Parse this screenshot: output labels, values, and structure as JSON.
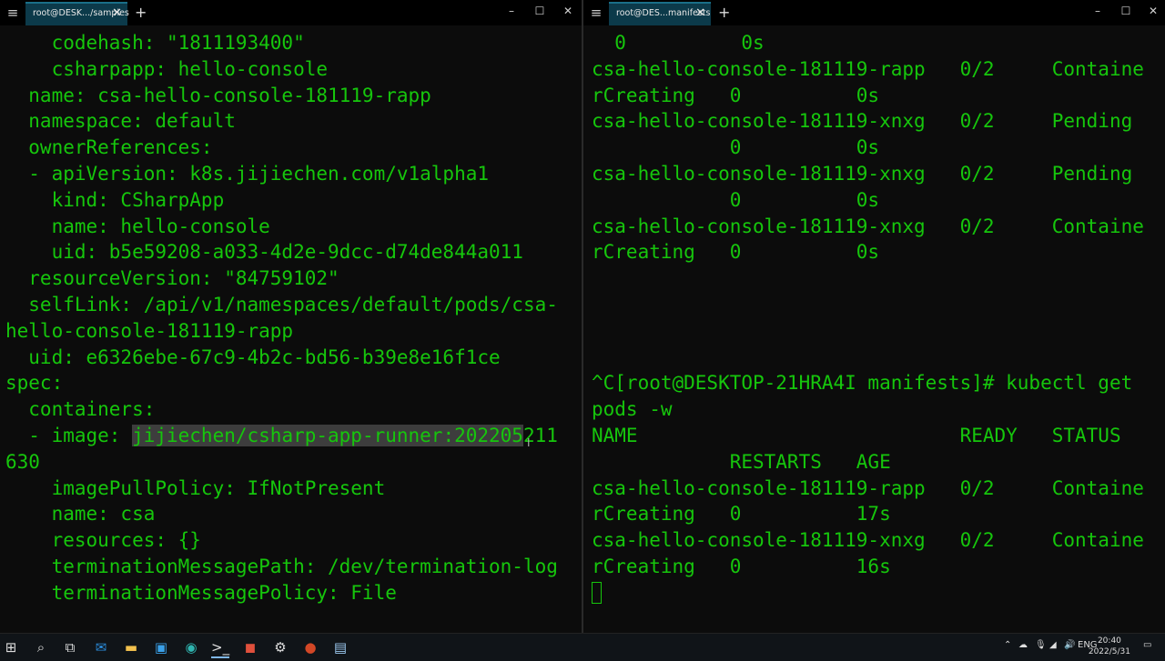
{
  "left_window": {
    "tab_title": "root@DESK.../samples",
    "lines": [
      {
        "text": "    codehash: \"1811193400\""
      },
      {
        "text": "    csharpapp: hello-console"
      },
      {
        "text": "  name: csa-hello-console-181119-rapp"
      },
      {
        "text": "  namespace: default"
      },
      {
        "text": "  ownerReferences:"
      },
      {
        "text": "  - apiVersion: k8s.jijiechen.com/v1alpha1"
      },
      {
        "text": "    kind: CSharpApp"
      },
      {
        "text": "    name: hello-console"
      },
      {
        "text": "    uid: b5e59208-a033-4d2e-9dcc-d74de844a011"
      },
      {
        "text": "  resourceVersion: \"84759102\""
      },
      {
        "text": "  selfLink: /api/v1/namespaces/default/pods/csa-"
      },
      {
        "text": "hello-console-181119-rapp"
      },
      {
        "text": "  uid: e6326ebe-67c9-4b2c-bd56-b39e8e16f1ce"
      },
      {
        "text": "spec:"
      },
      {
        "text": "  containers:"
      },
      {
        "pre": "  - image: ",
        "hl": "jijiechen/csharp-app-runner:202205",
        "post": "211"
      },
      {
        "text": "630"
      },
      {
        "text": "    imagePullPolicy: IfNotPresent"
      },
      {
        "text": "    name: csa"
      },
      {
        "text": "    resources: {}"
      },
      {
        "text": "    terminationMessagePath: /dev/termination-log"
      },
      {
        "text": "    terminationMessagePolicy: File"
      }
    ]
  },
  "right_window": {
    "tab_title": "root@DES...manifests",
    "lines": [
      {
        "text": "  0          0s"
      },
      {
        "text": "csa-hello-console-181119-rapp   0/2     Containe"
      },
      {
        "text": "rCreating   0          0s"
      },
      {
        "text": "csa-hello-console-181119-xnxg   0/2     Pending"
      },
      {
        "text": "            0          0s"
      },
      {
        "text": "csa-hello-console-181119-xnxg   0/2     Pending"
      },
      {
        "text": "            0          0s"
      },
      {
        "text": "csa-hello-console-181119-xnxg   0/2     Containe"
      },
      {
        "text": "rCreating   0          0s"
      },
      {
        "text": ""
      },
      {
        "text": ""
      },
      {
        "text": ""
      },
      {
        "text": ""
      },
      {
        "text": "^C[root@DESKTOP-21HRA4I manifests]# kubectl get"
      },
      {
        "text": "pods -w"
      },
      {
        "text": "NAME                            READY   STATUS"
      },
      {
        "text": "            RESTARTS   AGE"
      },
      {
        "text": "csa-hello-console-181119-rapp   0/2     Containe"
      },
      {
        "text": "rCreating   0          17s"
      },
      {
        "text": "csa-hello-console-181119-xnxg   0/2     Containe"
      },
      {
        "text": "rCreating   0          16s"
      },
      {
        "cursor": true
      }
    ]
  },
  "taskbar": {
    "icons": [
      "windows-start-icon",
      "search-icon",
      "task-view-icon",
      "mail-icon",
      "file-explorer-icon",
      "photos-icon",
      "edge-icon",
      "terminal-icon",
      "app-icon",
      "settings-icon",
      "powerpoint-icon",
      "notepad-icon"
    ],
    "tray_language": "ENG",
    "time": "20:40",
    "date": "2022/5/31"
  },
  "colors": {
    "terminal_text": "#16c60c",
    "terminal_bg": "#0c0c0c",
    "tab_bg": "#0c3a4a"
  }
}
